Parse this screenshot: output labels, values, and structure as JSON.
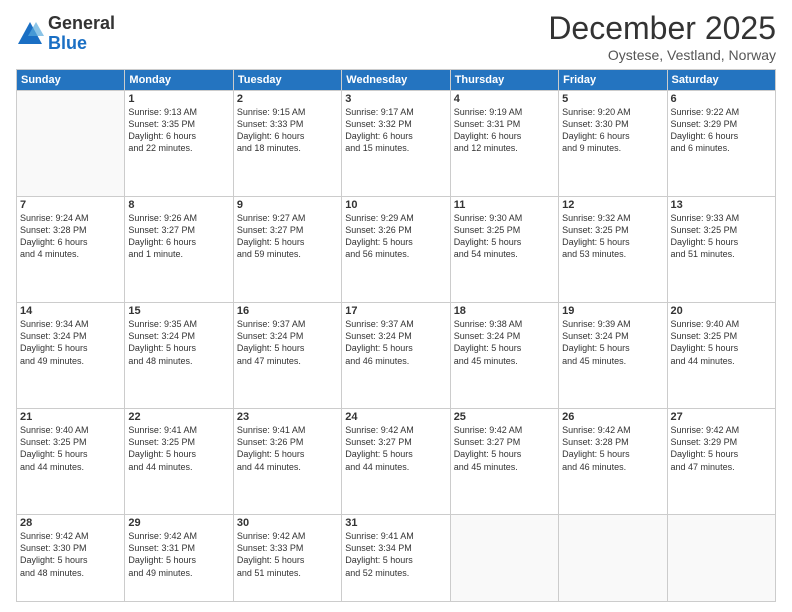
{
  "logo": {
    "general": "General",
    "blue": "Blue"
  },
  "header": {
    "month": "December 2025",
    "location": "Oystese, Vestland, Norway"
  },
  "days_of_week": [
    "Sunday",
    "Monday",
    "Tuesday",
    "Wednesday",
    "Thursday",
    "Friday",
    "Saturday"
  ],
  "weeks": [
    [
      {
        "day": "",
        "info": ""
      },
      {
        "day": "1",
        "info": "Sunrise: 9:13 AM\nSunset: 3:35 PM\nDaylight: 6 hours\nand 22 minutes."
      },
      {
        "day": "2",
        "info": "Sunrise: 9:15 AM\nSunset: 3:33 PM\nDaylight: 6 hours\nand 18 minutes."
      },
      {
        "day": "3",
        "info": "Sunrise: 9:17 AM\nSunset: 3:32 PM\nDaylight: 6 hours\nand 15 minutes."
      },
      {
        "day": "4",
        "info": "Sunrise: 9:19 AM\nSunset: 3:31 PM\nDaylight: 6 hours\nand 12 minutes."
      },
      {
        "day": "5",
        "info": "Sunrise: 9:20 AM\nSunset: 3:30 PM\nDaylight: 6 hours\nand 9 minutes."
      },
      {
        "day": "6",
        "info": "Sunrise: 9:22 AM\nSunset: 3:29 PM\nDaylight: 6 hours\nand 6 minutes."
      }
    ],
    [
      {
        "day": "7",
        "info": "Sunrise: 9:24 AM\nSunset: 3:28 PM\nDaylight: 6 hours\nand 4 minutes."
      },
      {
        "day": "8",
        "info": "Sunrise: 9:26 AM\nSunset: 3:27 PM\nDaylight: 6 hours\nand 1 minute."
      },
      {
        "day": "9",
        "info": "Sunrise: 9:27 AM\nSunset: 3:27 PM\nDaylight: 5 hours\nand 59 minutes."
      },
      {
        "day": "10",
        "info": "Sunrise: 9:29 AM\nSunset: 3:26 PM\nDaylight: 5 hours\nand 56 minutes."
      },
      {
        "day": "11",
        "info": "Sunrise: 9:30 AM\nSunset: 3:25 PM\nDaylight: 5 hours\nand 54 minutes."
      },
      {
        "day": "12",
        "info": "Sunrise: 9:32 AM\nSunset: 3:25 PM\nDaylight: 5 hours\nand 53 minutes."
      },
      {
        "day": "13",
        "info": "Sunrise: 9:33 AM\nSunset: 3:25 PM\nDaylight: 5 hours\nand 51 minutes."
      }
    ],
    [
      {
        "day": "14",
        "info": "Sunrise: 9:34 AM\nSunset: 3:24 PM\nDaylight: 5 hours\nand 49 minutes."
      },
      {
        "day": "15",
        "info": "Sunrise: 9:35 AM\nSunset: 3:24 PM\nDaylight: 5 hours\nand 48 minutes."
      },
      {
        "day": "16",
        "info": "Sunrise: 9:37 AM\nSunset: 3:24 PM\nDaylight: 5 hours\nand 47 minutes."
      },
      {
        "day": "17",
        "info": "Sunrise: 9:37 AM\nSunset: 3:24 PM\nDaylight: 5 hours\nand 46 minutes."
      },
      {
        "day": "18",
        "info": "Sunrise: 9:38 AM\nSunset: 3:24 PM\nDaylight: 5 hours\nand 45 minutes."
      },
      {
        "day": "19",
        "info": "Sunrise: 9:39 AM\nSunset: 3:24 PM\nDaylight: 5 hours\nand 45 minutes."
      },
      {
        "day": "20",
        "info": "Sunrise: 9:40 AM\nSunset: 3:25 PM\nDaylight: 5 hours\nand 44 minutes."
      }
    ],
    [
      {
        "day": "21",
        "info": "Sunrise: 9:40 AM\nSunset: 3:25 PM\nDaylight: 5 hours\nand 44 minutes."
      },
      {
        "day": "22",
        "info": "Sunrise: 9:41 AM\nSunset: 3:25 PM\nDaylight: 5 hours\nand 44 minutes."
      },
      {
        "day": "23",
        "info": "Sunrise: 9:41 AM\nSunset: 3:26 PM\nDaylight: 5 hours\nand 44 minutes."
      },
      {
        "day": "24",
        "info": "Sunrise: 9:42 AM\nSunset: 3:27 PM\nDaylight: 5 hours\nand 44 minutes."
      },
      {
        "day": "25",
        "info": "Sunrise: 9:42 AM\nSunset: 3:27 PM\nDaylight: 5 hours\nand 45 minutes."
      },
      {
        "day": "26",
        "info": "Sunrise: 9:42 AM\nSunset: 3:28 PM\nDaylight: 5 hours\nand 46 minutes."
      },
      {
        "day": "27",
        "info": "Sunrise: 9:42 AM\nSunset: 3:29 PM\nDaylight: 5 hours\nand 47 minutes."
      }
    ],
    [
      {
        "day": "28",
        "info": "Sunrise: 9:42 AM\nSunset: 3:30 PM\nDaylight: 5 hours\nand 48 minutes."
      },
      {
        "day": "29",
        "info": "Sunrise: 9:42 AM\nSunset: 3:31 PM\nDaylight: 5 hours\nand 49 minutes."
      },
      {
        "day": "30",
        "info": "Sunrise: 9:42 AM\nSunset: 3:33 PM\nDaylight: 5 hours\nand 51 minutes."
      },
      {
        "day": "31",
        "info": "Sunrise: 9:41 AM\nSunset: 3:34 PM\nDaylight: 5 hours\nand 52 minutes."
      },
      {
        "day": "",
        "info": ""
      },
      {
        "day": "",
        "info": ""
      },
      {
        "day": "",
        "info": ""
      }
    ]
  ]
}
